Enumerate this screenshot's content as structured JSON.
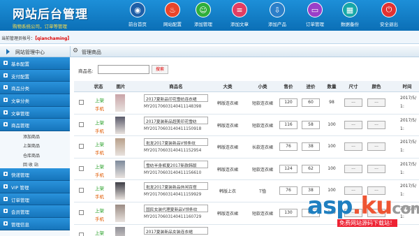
{
  "header": {
    "title": "网站后台管理",
    "subtitle": "购物系统公司，订单等管理",
    "nav": [
      {
        "label": "前台首页",
        "icon": "globe-icon",
        "color": "#1e5fa8"
      },
      {
        "label": "网站配置",
        "icon": "fire-icon",
        "color": "#e8452a"
      },
      {
        "label": "添加管理",
        "icon": "user-icon",
        "color": "#2fae3b"
      },
      {
        "label": "添加文章",
        "icon": "document-icon",
        "color": "#e23d63"
      },
      {
        "label": "添加产品",
        "icon": "download-icon",
        "color": "#2b7fc9"
      },
      {
        "label": "订单管理",
        "icon": "window-icon",
        "color": "#9a3fc8"
      },
      {
        "label": "数据备份",
        "icon": "chart-icon",
        "color": "#16a7a8"
      },
      {
        "label": "安全退出",
        "icon": "power-icon",
        "color": "#e23232"
      }
    ]
  },
  "userbar": {
    "label": "当前管理员帐号：",
    "username": "【qianchaming】"
  },
  "sidebar": {
    "title": "网站管理中心",
    "items": [
      {
        "label": "基本配置"
      },
      {
        "label": "支付配置"
      },
      {
        "label": "商品分类"
      },
      {
        "label": "文章分类"
      },
      {
        "label": "文章管理"
      },
      {
        "label": "商品管理",
        "sub": [
          "添加商品",
          "上架商品",
          "仓库商品",
          "回 收 站"
        ]
      },
      {
        "label": "快递管理"
      },
      {
        "label": "VIP 管理"
      },
      {
        "label": "订单管理"
      },
      {
        "label": "会员管理"
      },
      {
        "label": "管理信息"
      }
    ]
  },
  "main": {
    "title": "管理商品",
    "search": {
      "label": "商品名:",
      "value": "",
      "button": "搜索"
    },
    "columns": [
      "状态",
      "图片",
      "商品名",
      "大类",
      "小类",
      "售价",
      "进价",
      "数量",
      "尺寸",
      "颜色",
      "时间"
    ],
    "rows": [
      {
        "status1": "上架",
        "status2": "手机",
        "name": "2017夏新品印花雪纺连衣裙",
        "code": "MY20170603140411148398",
        "big": "韩版连衣裙",
        "small": "短款连衣裙",
        "price": "120",
        "cost": "60",
        "qty": "98",
        "size": "...",
        "color": "...",
        "time1": "2017/5/",
        "time2": "1:",
        "thumb": "#c9a4a8"
      },
      {
        "status1": "上架",
        "status2": "手机",
        "name": "2017夏装新品超美印花雪纺",
        "code": "MY20170603140411150918",
        "big": "韩版连衣裙",
        "small": "短款连衣裙",
        "price": "116",
        "cost": "58",
        "qty": "100",
        "size": "...",
        "color": "...",
        "time1": "2017/5/",
        "time2": "1:",
        "thumb": "#5a5a6a"
      },
      {
        "status1": "上架",
        "status2": "手机",
        "name": "批发2017夏装新品V领条纹",
        "code": "MY20170603140411152954",
        "big": "韩版连衣裙",
        "small": "长款连衣裙",
        "price": "76",
        "cost": "38",
        "qty": "100",
        "size": "...",
        "color": "...",
        "time1": "2017/5/",
        "time2": "1:",
        "thumb": "#b8a08a"
      },
      {
        "status1": "上架",
        "status2": "手机",
        "name": "雪纺半身裤夏2017新款韩版",
        "code": "MY20170603140411156610",
        "big": "韩版连衣裙",
        "small": "短款连衣裙",
        "price": "124",
        "cost": "62",
        "qty": "100",
        "size": "...",
        "color": "...",
        "time1": "2017/5/",
        "time2": "1:",
        "thumb": "#7d8a9c"
      },
      {
        "status1": "上架",
        "status2": "手机",
        "name": "批发2017夏装新品休闲百搭",
        "code": "MY20170603140411159929",
        "big": "韩版上衣",
        "small": "T恤",
        "price": "76",
        "cost": "38",
        "qty": "100",
        "size": "...",
        "color": "...",
        "time1": "2017/5/",
        "time2": "1:",
        "thumb": "#3e3e46"
      },
      {
        "status1": "上架",
        "status2": "手机",
        "name": "国民女装代理夏新品V领条纹",
        "code": "MY20170603140411160729",
        "big": "韩版连衣裙",
        "small": "短款连衣裙",
        "price": "130",
        "cost": "65",
        "qty": "100",
        "size": "...",
        "color": "...",
        "time1": "2017/5/",
        "time2": "1:",
        "thumb": "#9b8c84"
      },
      {
        "status1": "上架",
        "status2": "手机",
        "name": "2017夏装新品女装连衣裙",
        "code": "",
        "big": "",
        "small": "",
        "price": "",
        "cost": "",
        "qty": "",
        "size": "",
        "color": "",
        "time1": "",
        "time2": "",
        "thumb": "#8f8f96"
      }
    ]
  },
  "watermark": {
    "main": "asp",
    "dot": ".",
    "ku": "ku",
    "com": "com",
    "sub": "免费网站源码下载站！"
  }
}
